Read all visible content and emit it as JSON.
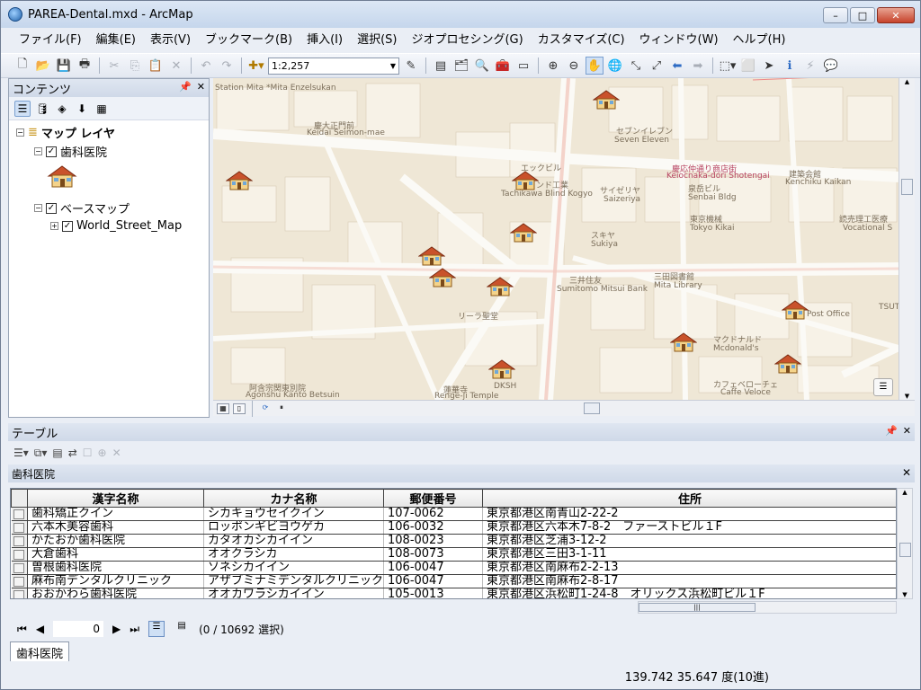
{
  "window": {
    "title": "PAREA-Dental.mxd - ArcMap",
    "min": "–",
    "max": "□",
    "close": "✕"
  },
  "menu": [
    "ファイル(F)",
    "編集(E)",
    "表示(V)",
    "ブックマーク(B)",
    "挿入(I)",
    "選択(S)",
    "ジオプロセシング(G)",
    "カスタマイズ(C)",
    "ウィンドウ(W)",
    "ヘルプ(H)"
  ],
  "toolbar": {
    "scale": "1:2,257"
  },
  "contents": {
    "title": "コンテンツ",
    "root": "マップ レイヤ",
    "layer1": "歯科医院",
    "group": "ベースマップ",
    "layer2": "World_Street_Map"
  },
  "map": {
    "labels": [
      "Station Mita *Mita Enzelsukan",
      "慶大正門前",
      "Keidai Seimon-mae",
      "セブンイレブン",
      "Seven Eleven",
      "エックビル",
      "インド工業",
      "Tachikawa Blind Kogyo",
      "サイゼリヤ",
      "Saizeriya",
      "泉岳ビル",
      "Senbai Bldg",
      "慶応仲通り商店街",
      "Keiocnaka-dori Shotengai",
      "建築会館",
      "Kenchiku Kaikan",
      "東京機械",
      "Tokyo Kikai",
      "読売理工医療",
      "Vocational S",
      "スキヤ",
      "Sukiya",
      "三井住友",
      "Sumitomo Mitsui Bank",
      "三田図書館",
      "Mita Library",
      "リーラ聖堂",
      "マクドナルド",
      "Mcdonald's",
      "TSUT",
      "DKSH",
      "阿含宗関東別院",
      "Agonshu Kanto Betsuin",
      "蓮華寺",
      "Renge-ji Temple",
      "カフェベローチェ",
      "Caffe Veloce",
      "Post Office"
    ]
  },
  "table": {
    "pane_title": "テーブル",
    "tab_title": "歯科医院",
    "headers": [
      "漢字名称",
      "カナ名称",
      "郵便番号",
      "住所"
    ],
    "rows": [
      [
        "歯科矯正クイン",
        "シカキョウセイクイン",
        "107-0062",
        "東京都港区南青山2-22-2"
      ],
      [
        "六本木美容歯科",
        "ロッポンギビヨウゲカ",
        "106-0032",
        "東京都港区六本木7-8-2　ファーストビル１F"
      ],
      [
        "かたおか歯科医院",
        "カタオカシカイイン",
        "108-0023",
        "東京都港区芝浦3-12-2"
      ],
      [
        "大倉歯科",
        "オオクラシカ",
        "108-0073",
        "東京都港区三田3-1-11"
      ],
      [
        "曽根歯科医院",
        "ソネシカイイン",
        "106-0047",
        "東京都港区南麻布2-2-13"
      ],
      [
        "麻布南デンタルクリニック",
        "アザブミナミデンタルクリニック",
        "106-0047",
        "東京都港区南麻布2-8-17"
      ],
      [
        "おおかわら歯科医院",
        "オオカワラシカイイン",
        "105-0013",
        "東京都港区浜松町1-24-8　オリックス浜松町ビル１F"
      ]
    ],
    "record": "0",
    "selection": "(0 / 10692 選択)",
    "bottom_tab": "歯科医院"
  },
  "status": {
    "coords": "139.742  35.647 度(10進)"
  }
}
